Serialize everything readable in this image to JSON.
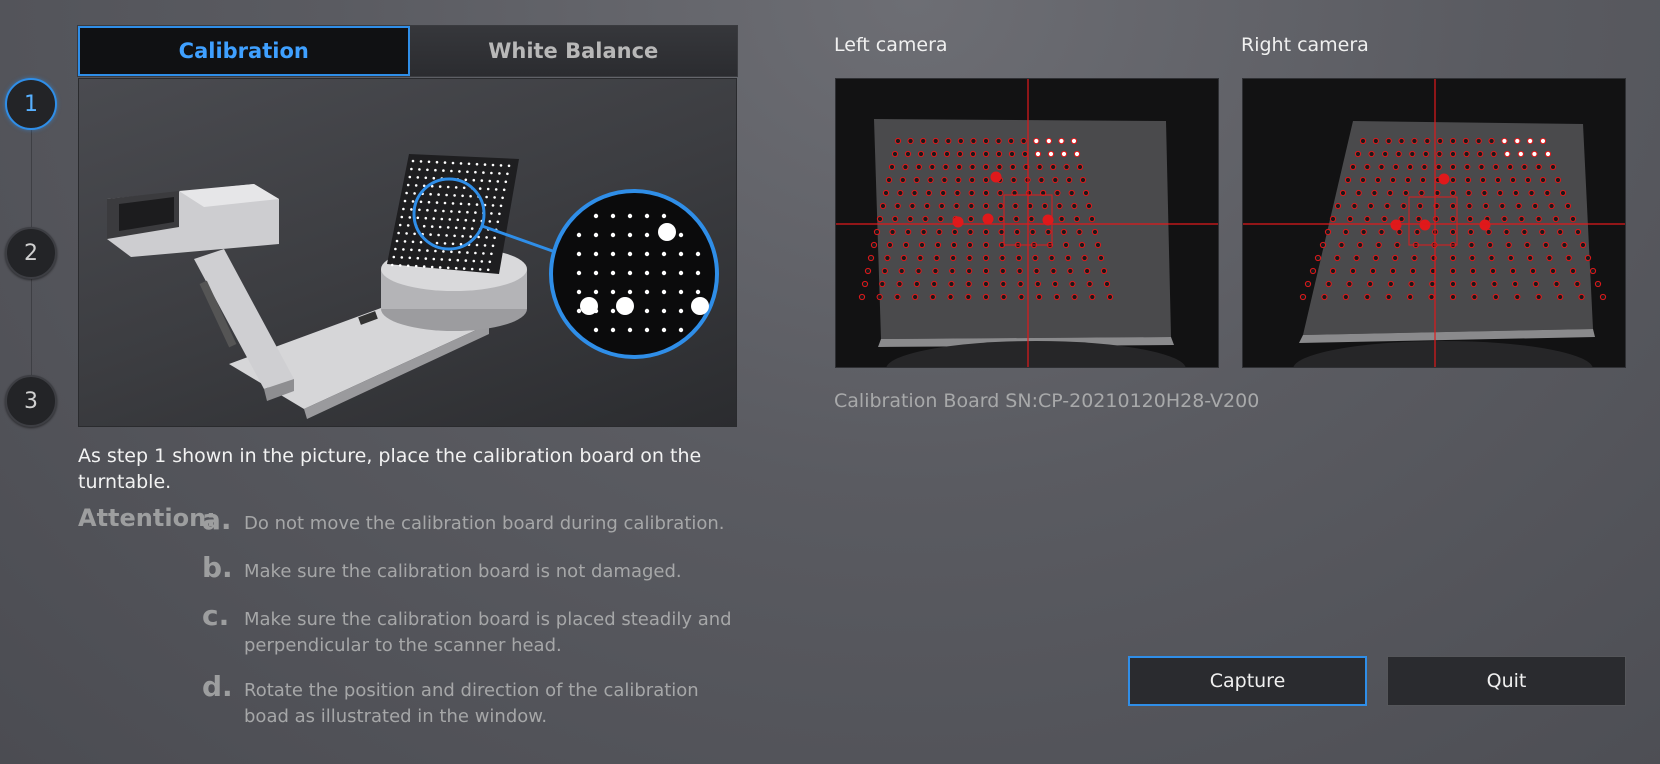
{
  "steps": [
    "1",
    "2",
    "3"
  ],
  "tabs": {
    "calibration": "Calibration",
    "white_balance": "White Balance"
  },
  "instruction": "As step 1 shown in the picture, place the calibration board on the turntable.",
  "attention": {
    "title": "Attention:",
    "items": [
      {
        "letter": "a.",
        "text": "Do not move the calibration board during calibration."
      },
      {
        "letter": "b.",
        "text": "Make sure the calibration board is not damaged."
      },
      {
        "letter": "c.",
        "text": "Make sure the calibration board is placed steadily and perpendicular to the scanner head."
      },
      {
        "letter": "d.",
        "text": "Rotate the position and direction of the calibration boad as illustrated in the window."
      }
    ]
  },
  "cameras": {
    "left_label": "Left camera",
    "right_label": "Right camera"
  },
  "board_sn": "Calibration Board SN:CP-20210120H28-V200",
  "buttons": {
    "capture": "Capture",
    "quit": "Quit"
  },
  "colors": {
    "accent": "#2f8ee8",
    "marker": "#e0191b"
  }
}
